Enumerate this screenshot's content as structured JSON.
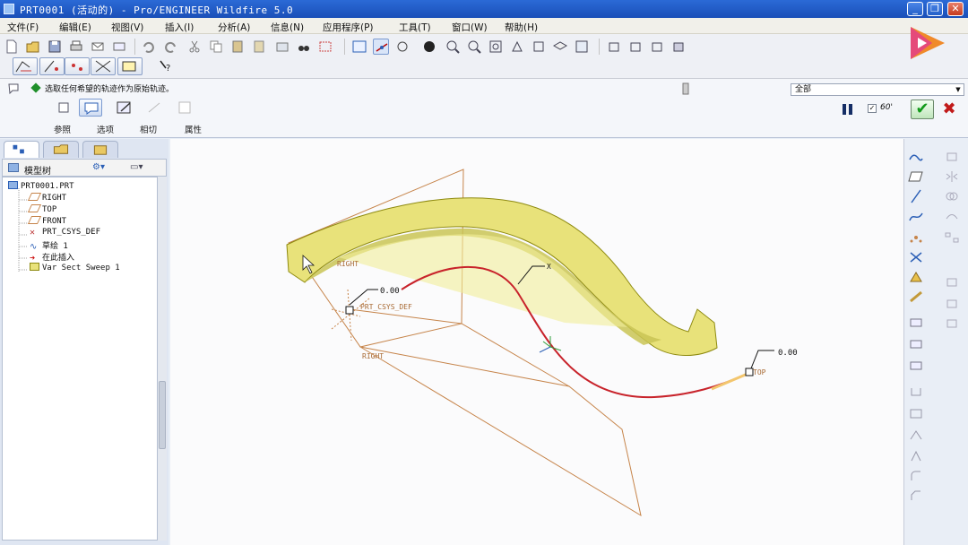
{
  "window": {
    "title": "PRT0001 (活动的) - Pro/ENGINEER Wildfire 5.0",
    "minimize": "_",
    "restore": "❐",
    "close": "✕"
  },
  "menu": [
    "文件(F)",
    "编辑(E)",
    "视图(V)",
    "插入(I)",
    "分析(A)",
    "信息(N)",
    "应用程序(P)",
    "工具(T)",
    "窗口(W)",
    "帮助(H)"
  ],
  "dashboard": {
    "prompt": "选取任何希望的轨迹作为原始轨迹。",
    "filter_value": "全部",
    "tabs": [
      "参照",
      "选项",
      "相切",
      "属性"
    ],
    "preview_label": "60'",
    "ok_symbol": "✔",
    "cancel_symbol": "✖"
  },
  "model_tree": {
    "header": "模型树",
    "items": [
      {
        "label": "PRT0001.PRT",
        "icon": "part-icon"
      },
      {
        "label": "RIGHT",
        "icon": "datum-plane-icon"
      },
      {
        "label": "TOP",
        "icon": "datum-plane-icon"
      },
      {
        "label": "FRONT",
        "icon": "datum-plane-icon"
      },
      {
        "label": "PRT_CSYS_DEF",
        "icon": "csys-icon"
      },
      {
        "label": "草绘 1",
        "icon": "sketch-icon"
      },
      {
        "label": "在此插入",
        "icon": "insert-here-icon"
      },
      {
        "label": "Var Sect Sweep 1",
        "icon": "feature-icon"
      }
    ]
  },
  "viewport": {
    "labels": {
      "right_top": "RIGHT",
      "right_bottom": "RIGHT",
      "csys": "PRT_CSYS_DEF",
      "top": "TOP",
      "dim_start": "0.00",
      "dim_end": "0.00",
      "traj_tag": "X"
    },
    "colors": {
      "solid_fill": "#e8e27a",
      "solid_edge": "#8e8a10",
      "datum": "#c6844a",
      "trajectory": "#c8232b",
      "background": "#fbfbfc"
    }
  }
}
